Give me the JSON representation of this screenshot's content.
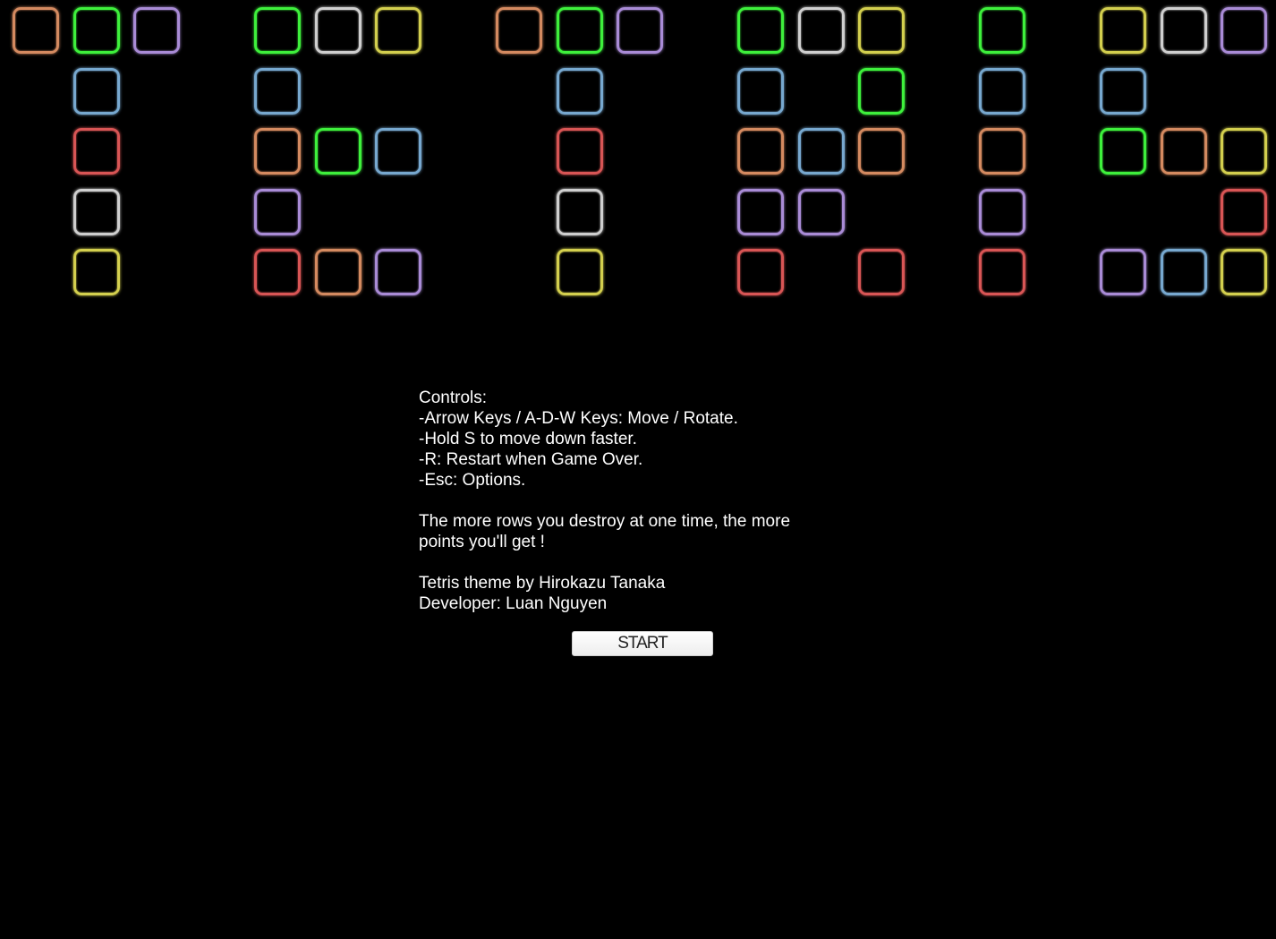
{
  "colors": {
    "orange": "#d48a60",
    "green": "#3ef03c",
    "purple": "#a98bd6",
    "blue": "#77a8cf",
    "red": "#d85555",
    "white": "#cfcfcf",
    "yellow": "#d3cf4e",
    "background": "#000000"
  },
  "logo": {
    "letters": [
      {
        "name": "T",
        "rows": [
          [
            "orange",
            "green",
            "purple"
          ],
          [
            null,
            "blue",
            null
          ],
          [
            null,
            "red",
            null
          ],
          [
            null,
            "white",
            null
          ],
          [
            null,
            "yellow",
            null
          ]
        ]
      },
      {
        "name": "E",
        "rows": [
          [
            "green",
            "white",
            "yellow"
          ],
          [
            "blue",
            null,
            null
          ],
          [
            "orange",
            "green",
            "blue"
          ],
          [
            "purple",
            null,
            null
          ],
          [
            "red",
            "orange",
            "purple"
          ]
        ]
      },
      {
        "name": "T",
        "rows": [
          [
            "orange",
            "green",
            "purple"
          ],
          [
            null,
            "blue",
            null
          ],
          [
            null,
            "red",
            null
          ],
          [
            null,
            "white",
            null
          ],
          [
            null,
            "yellow",
            null
          ]
        ]
      },
      {
        "name": "R",
        "rows": [
          [
            "green",
            "white",
            "yellow"
          ],
          [
            "blue",
            null,
            "green"
          ],
          [
            "orange",
            "blue",
            "orange"
          ],
          [
            "purple",
            "purple",
            null
          ],
          [
            "red",
            null,
            "red"
          ]
        ]
      },
      {
        "name": "I",
        "rows": [
          [
            "green"
          ],
          [
            "blue"
          ],
          [
            "orange"
          ],
          [
            "purple"
          ],
          [
            "red"
          ]
        ]
      },
      {
        "name": "S",
        "rows": [
          [
            "yellow",
            "white",
            "purple"
          ],
          [
            "blue",
            null,
            null
          ],
          [
            "green",
            "orange",
            "yellow"
          ],
          [
            null,
            null,
            "red"
          ],
          [
            "purple",
            "blue",
            "yellow"
          ]
        ]
      }
    ]
  },
  "info": {
    "controls_heading": "Controls:",
    "control_1": "-Arrow Keys / A-D-W Keys: Move / Rotate.",
    "control_2": "-Hold S to move down faster.",
    "control_3": "-R: Restart when Game Over.",
    "control_4": "-Esc: Options.",
    "tip": "The more rows you destroy at one time, the more points you'll get !",
    "credit_theme": "Tetris theme by Hirokazu Tanaka",
    "credit_developer": "Developer: Luan Nguyen"
  },
  "start_button": {
    "label": "START"
  }
}
